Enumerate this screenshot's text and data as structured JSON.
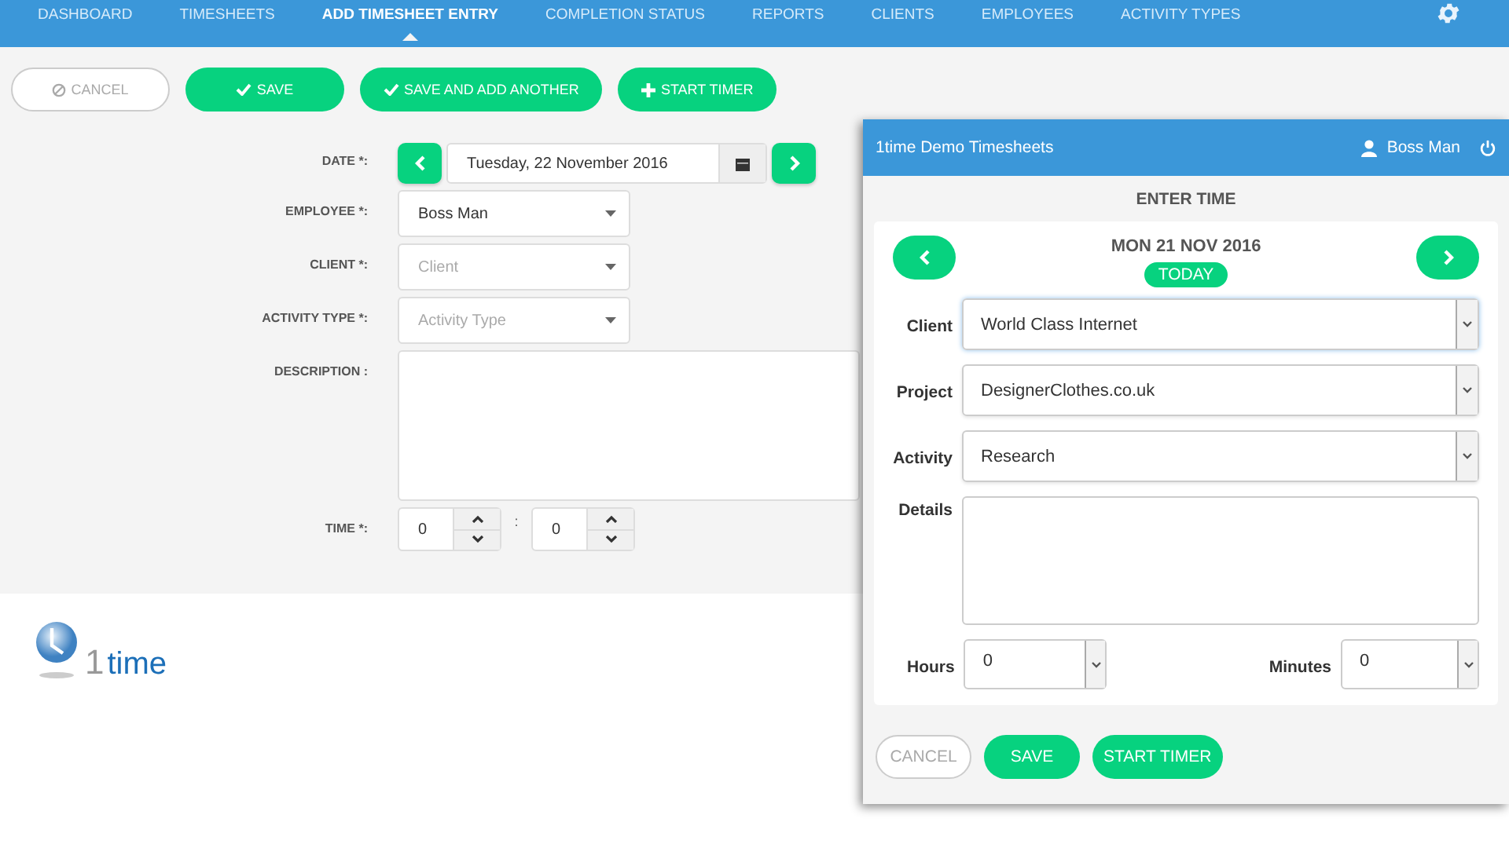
{
  "nav": {
    "items": [
      {
        "label": "DASHBOARD",
        "selected": false
      },
      {
        "label": "TIMESHEETS",
        "selected": false
      },
      {
        "label": "ADD TIMESHEET ENTRY",
        "selected": true
      },
      {
        "label": "COMPLETION STATUS",
        "selected": false
      },
      {
        "label": "REPORTS",
        "selected": false
      },
      {
        "label": "CLIENTS",
        "selected": false
      },
      {
        "label": "EMPLOYEES",
        "selected": false
      },
      {
        "label": "ACTIVITY TYPES",
        "selected": false
      }
    ]
  },
  "toolbar": {
    "buttons": [
      {
        "label": "CANCEL",
        "kind": "cancel"
      },
      {
        "label": "SAVE",
        "kind": "confirm"
      },
      {
        "label": "SAVE AND ADD ANOTHER",
        "kind": "confirm"
      },
      {
        "label": "START TIMER",
        "kind": "add"
      }
    ]
  },
  "form": {
    "fields": [
      {
        "label": "DATE *:",
        "kind": "date",
        "value": "Tuesday, 22 November 2016"
      },
      {
        "label": "EMPLOYEE *:",
        "kind": "select",
        "value": "Boss Man"
      },
      {
        "label": "CLIENT *:",
        "kind": "select",
        "placeholder": "Client"
      },
      {
        "label": "ACTIVITY TYPE *:",
        "kind": "select",
        "placeholder": "Activity Type"
      },
      {
        "label": "DESCRIPTION :",
        "kind": "textarea"
      },
      {
        "label": "TIME *:",
        "kind": "time",
        "values": [
          "0",
          "0"
        ],
        "separator": ":"
      }
    ]
  },
  "logo": {
    "numeral": "1",
    "word": "time"
  },
  "panel": {
    "title": "1time Demo Timesheets",
    "user": "Boss Man",
    "heading": "ENTER TIME",
    "date": "MON 21 NOV 2016",
    "today": "TODAY",
    "fields": [
      {
        "label": "Client",
        "kind": "select",
        "value": "World Class Internet"
      },
      {
        "label": "Project",
        "kind": "select",
        "value": "DesignerClothes.co.uk"
      },
      {
        "label": "Activity",
        "kind": "select",
        "value": "Research"
      },
      {
        "label": "Details",
        "kind": "textarea"
      }
    ],
    "hours": {
      "label": "Hours",
      "value": "0"
    },
    "minutes": {
      "label": "Minutes",
      "value": "0"
    },
    "buttons": [
      {
        "label": "CANCEL",
        "kind": "cancel"
      },
      {
        "label": "SAVE",
        "kind": "confirm"
      },
      {
        "label": "START TIMER",
        "kind": "confirm"
      }
    ]
  }
}
